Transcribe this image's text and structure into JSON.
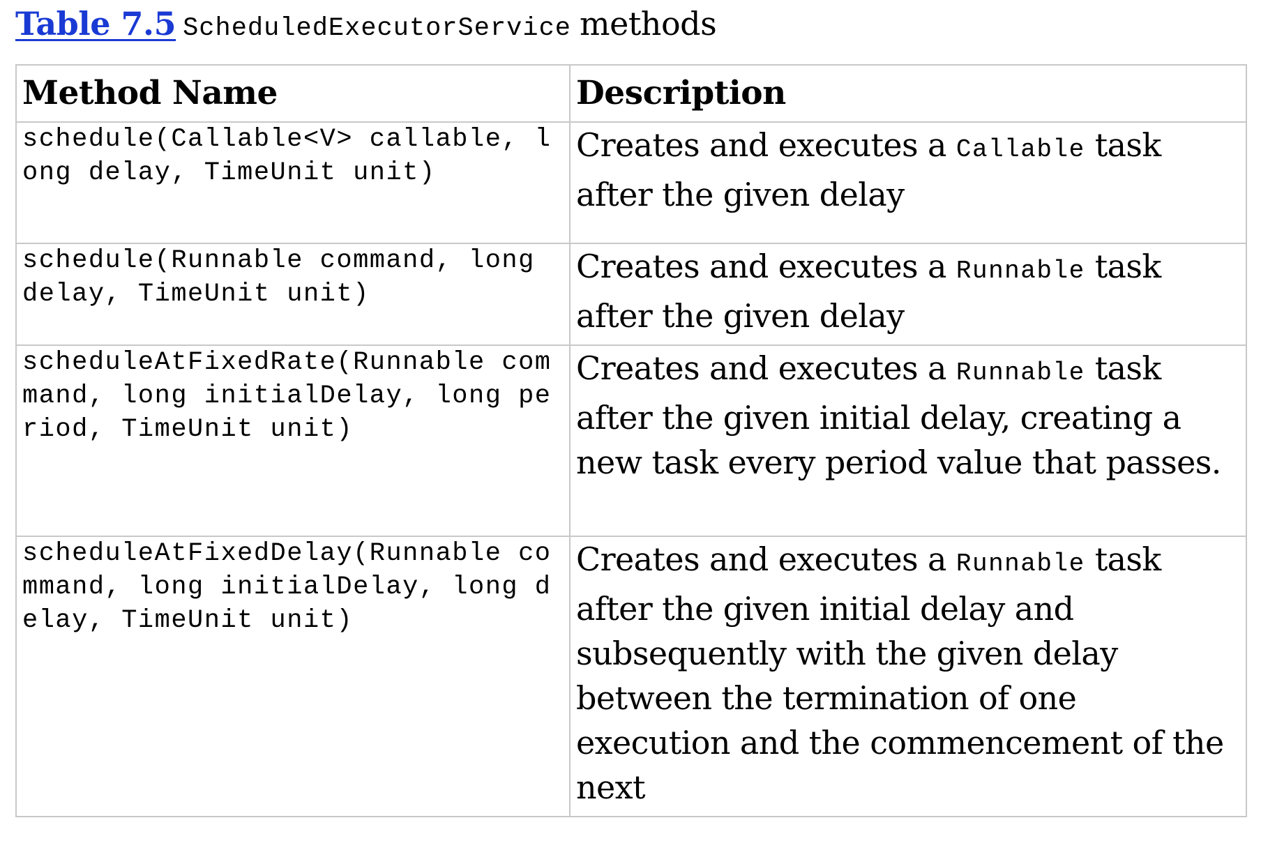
{
  "caption": {
    "label": "Table 7.5",
    "code": "ScheduledExecutorService",
    "text": "methods"
  },
  "table": {
    "headers": {
      "method": "Method Name",
      "description": "Description"
    },
    "rows": [
      {
        "method": "schedule(Callable<V> callable, long delay, TimeUnit unit)",
        "desc_before": "Creates and executes a ",
        "desc_code": "Callable",
        "desc_after": " task after the given delay"
      },
      {
        "method": "schedule(Runnable command, long delay, TimeUnit unit)",
        "desc_before": "Creates and executes a ",
        "desc_code": "Runnable",
        "desc_after": " task after the given delay"
      },
      {
        "method": "scheduleAtFixedRate(Runnable command, long initialDelay, long period, TimeUnit unit)",
        "desc_before": "Creates and executes a ",
        "desc_code": "Runnable",
        "desc_after": " task after the given initial delay, creating a new task every period value that passes."
      },
      {
        "method": "scheduleAtFixedDelay(Runnable command, long initialDelay, long delay, TimeUnit unit)",
        "desc_before": "Creates and executes a ",
        "desc_code": "Runnable",
        "desc_after": " task after the given initial delay and subsequently with the given delay between the termination of one execution and the commencement of the next"
      }
    ]
  }
}
